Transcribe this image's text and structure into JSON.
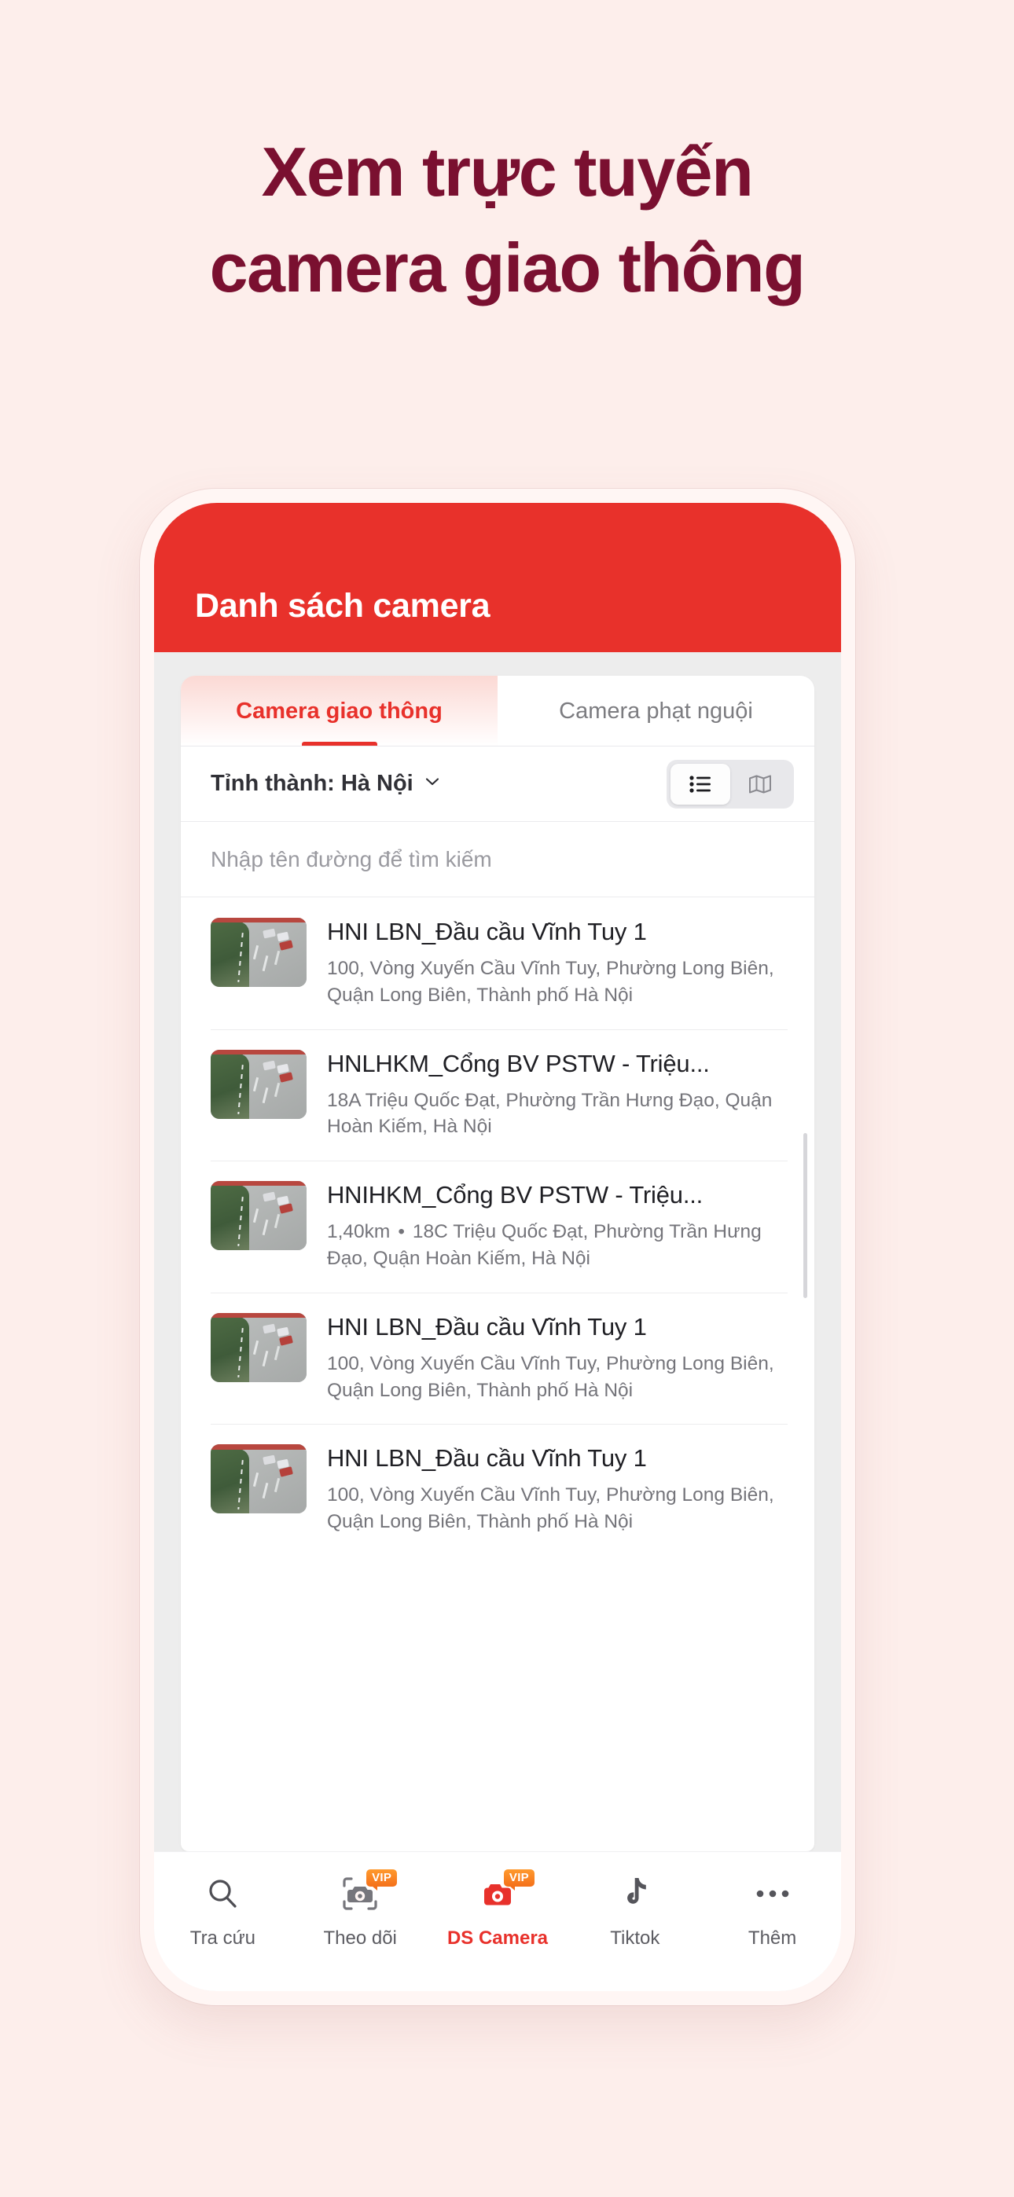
{
  "promo": {
    "headline_line1": "Xem trực tuyến",
    "headline_line2": "camera giao thông",
    "headline_color": "#7A1030",
    "background_color": "#FDEEEB"
  },
  "app": {
    "header": {
      "title": "Danh sách camera",
      "color": "#E8312B"
    },
    "tabs": [
      {
        "label": "Camera giao thông",
        "active": true
      },
      {
        "label": "Camera phạt nguội",
        "active": false
      }
    ],
    "filter": {
      "province_label": "Tỉnh thành: Hà Nội",
      "chevron_icon": "chevron-down-icon",
      "view_toggle": [
        {
          "icon": "list-view-icon",
          "selected": true
        },
        {
          "icon": "map-view-icon",
          "selected": false
        }
      ]
    },
    "search": {
      "placeholder": "Nhập tên đường để tìm kiếm",
      "value": ""
    },
    "camera_list": [
      {
        "title": "HNI LBN_Đầu cầu Vĩnh Tuy 1",
        "distance": "",
        "address": "100, Vòng Xuyến Cầu Vĩnh Tuy, Phường Long Biên, Quận Long Biên, Thành phố Hà Nội"
      },
      {
        "title": "HNLHKM_Cổng BV PSTW - Triệu...",
        "distance": "",
        "address": "18A Triệu Quốc Đạt, Phường Trần Hưng Đạo, Quận Hoàn Kiếm, Hà Nội"
      },
      {
        "title": "HNIHKM_Cổng BV PSTW - Triệu...",
        "distance": "1,40km",
        "address": "18C Triệu Quốc Đạt, Phường Trần Hưng Đạo, Quận Hoàn Kiếm, Hà Nội"
      },
      {
        "title": "HNI LBN_Đầu cầu Vĩnh Tuy 1",
        "distance": "",
        "address": "100, Vòng Xuyến Cầu Vĩnh Tuy, Phường Long Biên, Quận Long Biên, Thành phố Hà Nội"
      },
      {
        "title": "HNI LBN_Đầu cầu Vĩnh Tuy 1",
        "distance": "",
        "address": "100, Vòng Xuyến Cầu Vĩnh Tuy, Phường Long Biên, Quận Long Biên, Thành phố Hà Nội"
      }
    ],
    "bottom_nav": [
      {
        "label": "Tra cứu",
        "icon": "search-icon",
        "badge": "",
        "active": false
      },
      {
        "label": "Theo dõi",
        "icon": "camera-scan-icon",
        "badge": "VIP",
        "active": false
      },
      {
        "label": "DS Camera",
        "icon": "camera-icon",
        "badge": "VIP",
        "active": true
      },
      {
        "label": "Tiktok",
        "icon": "tiktok-icon",
        "badge": "",
        "active": false
      },
      {
        "label": "Thêm",
        "icon": "more-dots-icon",
        "badge": "",
        "active": false
      }
    ]
  }
}
